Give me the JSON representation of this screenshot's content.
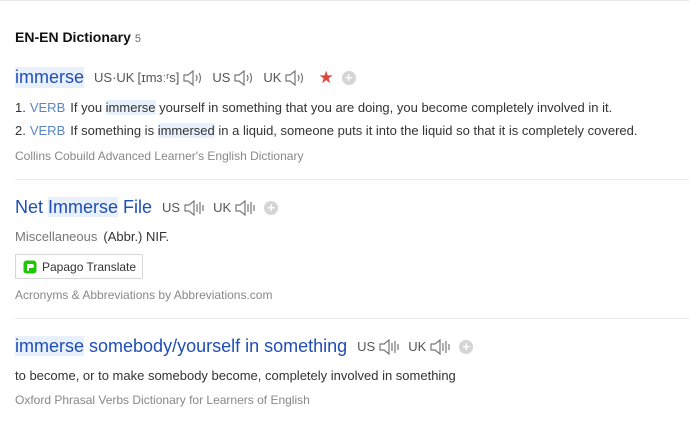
{
  "header": {
    "title": "EN-EN Dictionary",
    "count": "5"
  },
  "entries": [
    {
      "headword": "immerse",
      "pron_label_1": "US·UK",
      "phonetic": "[ɪmɜːʳs]",
      "pron_label_2": "US",
      "pron_label_3": "UK",
      "definitions": [
        {
          "num": "1.",
          "pos": "VERB",
          "pre": "If you ",
          "hl": "immerse",
          "post": " yourself in something that you are doing, you become completely involved in it."
        },
        {
          "num": "2.",
          "pos": "VERB",
          "pre": "If something is ",
          "hl": "immersed",
          "post": " in a liquid, someone puts it into the liquid so that it is completely covered."
        }
      ],
      "source": "Collins Cobuild Advanced Learner's English Dictionary"
    },
    {
      "headword_pre": "Net ",
      "headword_hl": "Immerse",
      "headword_post": " File",
      "us": "US",
      "uk": "UK",
      "misc_1": "Miscellaneous",
      "misc_2": "(Abbr.) NIF.",
      "papago_label": "Papago Translate",
      "source": "Acronyms & Abbreviations by Abbreviations.com"
    },
    {
      "headword_hl": "immerse",
      "headword_post": " somebody/yourself in something",
      "us": "US",
      "uk": "UK",
      "definition": "to become, or to make somebody become, completely involved in something",
      "source": "Oxford Phrasal Verbs Dictionary for Learners of English"
    }
  ],
  "icons": {
    "speaker": "speaker-icon",
    "star": "star-icon",
    "add": "plus-icon",
    "papago": "papago-icon"
  },
  "colors": {
    "headword": "#1f4eb4",
    "pos": "#5a86c4",
    "star": "#e0463c",
    "highlight": "#e8f0fb"
  }
}
